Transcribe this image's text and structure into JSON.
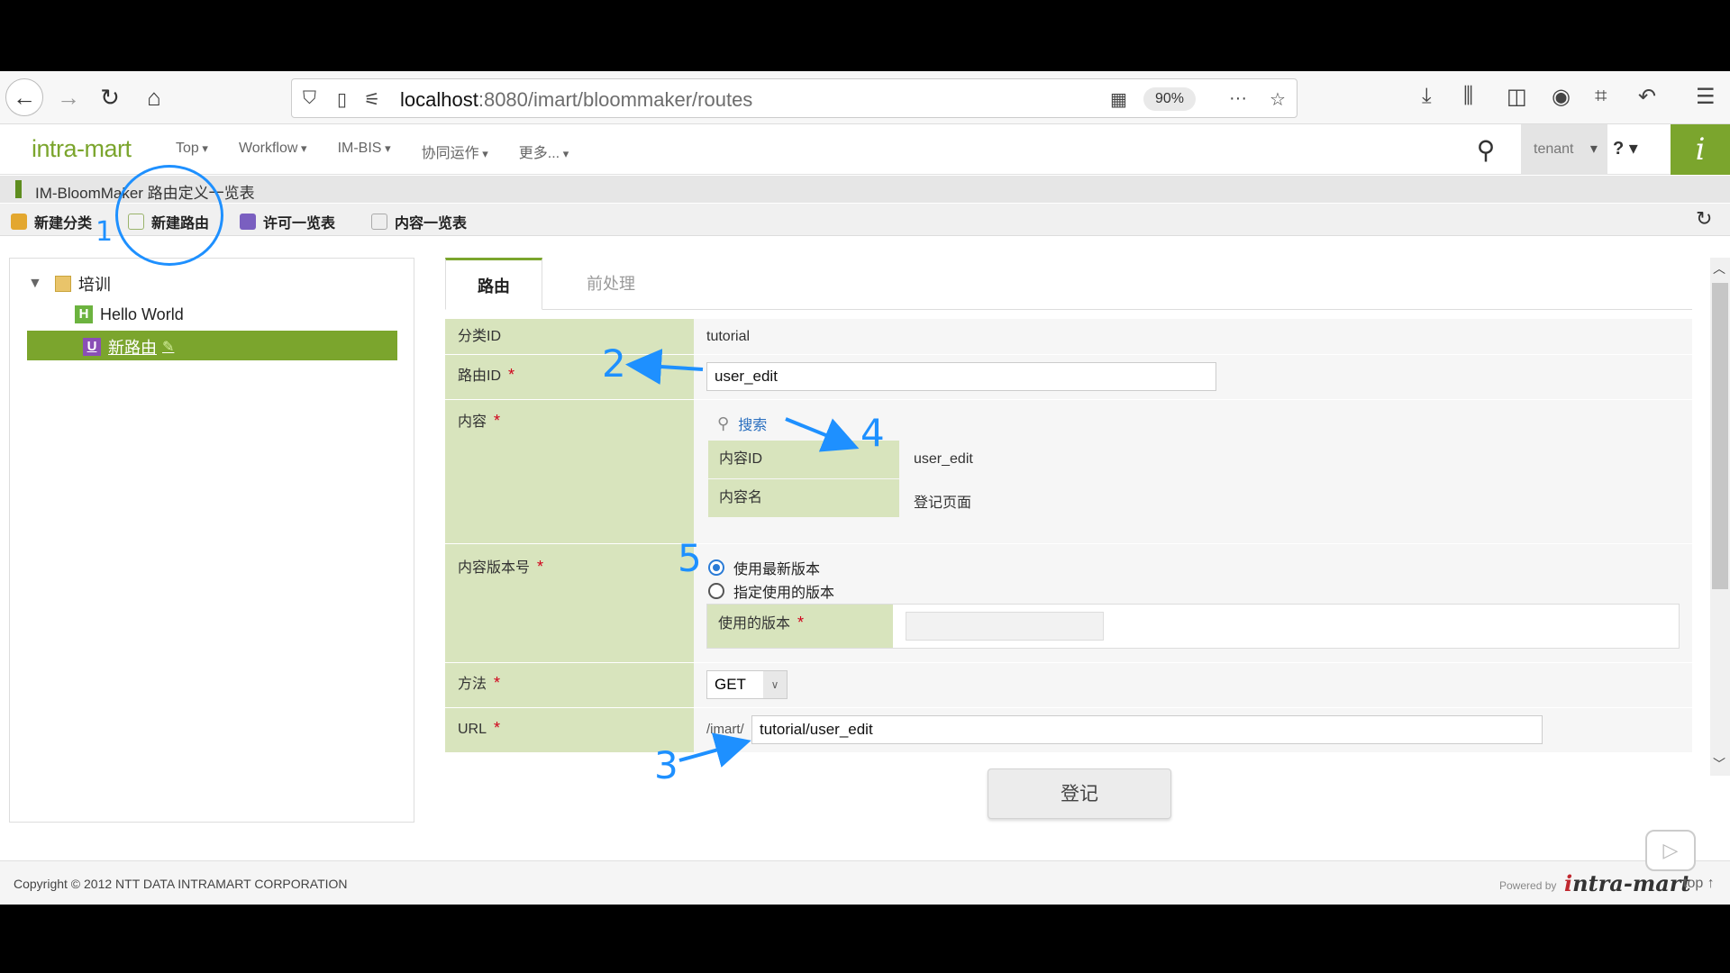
{
  "browser": {
    "url_host": "localhost",
    "url_path": ":8080/imart/bloommaker/routes",
    "zoom": "90%"
  },
  "header": {
    "logo": "intra-mart",
    "menu": [
      "Top",
      "Workflow",
      "IM-BIS",
      "协同运作",
      "更多..."
    ],
    "tenant": "tenant",
    "help": "?"
  },
  "breadcrumb": "IM-BloomMaker 路由定义一览表",
  "actions": {
    "new_category": "新建分类",
    "new_route": "新建路由",
    "permission_list": "许可一览表",
    "content_list": "内容一览表"
  },
  "tree": {
    "folder": "培训",
    "items": [
      {
        "badge": "H",
        "label": "Hello World"
      },
      {
        "badge": "U",
        "label": "新路由"
      }
    ]
  },
  "tabs": {
    "route": "路由",
    "preprocess": "前处理"
  },
  "form": {
    "category_id_label": "分类ID",
    "category_id_value": "tutorial",
    "route_id_label": "路由ID",
    "route_id_value": "user_edit",
    "content_label": "内容",
    "search_link": "搜索",
    "content_id_label": "内容ID",
    "content_id_value": "user_edit",
    "content_name_label": "内容名",
    "content_name_value": "登记页面",
    "version_label": "内容版本号",
    "radio_latest": "使用最新版本",
    "radio_specific": "指定使用的版本",
    "used_version_label": "使用的版本",
    "used_version_value": "",
    "method_label": "方法",
    "method_value": "GET",
    "url_label": "URL",
    "url_prefix": "/imart/",
    "url_value": "tutorial/user_edit",
    "required_mark": "*"
  },
  "submit_label": "登记",
  "footer": {
    "copyright": "Copyright © 2012 NTT DATA INTRAMART CORPORATION",
    "powered": "Powered by",
    "brand_prefix": "i",
    "brand": "ntra-mart",
    "top_link": "top ↑"
  },
  "annotations": [
    "1",
    "2",
    "3",
    "4",
    "5"
  ],
  "colors": {
    "accent": "#7ba52d",
    "label_bg": "#d8e4bd",
    "annotation": "#1e90ff",
    "required": "#d0021b"
  }
}
